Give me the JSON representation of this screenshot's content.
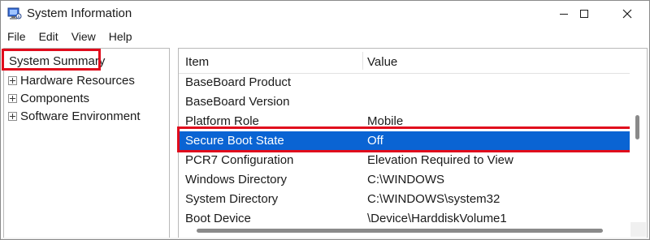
{
  "window": {
    "title": "System Information",
    "icon": "system-information-icon",
    "controls": [
      "minimize-icon",
      "maximize-icon",
      "close-icon"
    ]
  },
  "menu": [
    "File",
    "Edit",
    "View",
    "Help"
  ],
  "tree": {
    "root": "System Summary",
    "children": [
      "Hardware Resources",
      "Components",
      "Software Environment"
    ]
  },
  "list": {
    "headers": {
      "item": "Item",
      "value": "Value"
    },
    "rows": [
      {
        "item": "BaseBoard Product",
        "value": ""
      },
      {
        "item": "BaseBoard Version",
        "value": ""
      },
      {
        "item": "Platform Role",
        "value": "Mobile"
      },
      {
        "item": "Secure Boot State",
        "value": "Off",
        "selected": true
      },
      {
        "item": "PCR7 Configuration",
        "value": "Elevation Required to View"
      },
      {
        "item": "Windows Directory",
        "value": "C:\\WINDOWS"
      },
      {
        "item": "System Directory",
        "value": "C:\\WINDOWS\\system32"
      },
      {
        "item": "Boot Device",
        "value": "\\Device\\HarddiskVolume1"
      }
    ]
  },
  "colors": {
    "selection": "#0a64d3",
    "highlight_box": "#e00b1c"
  }
}
